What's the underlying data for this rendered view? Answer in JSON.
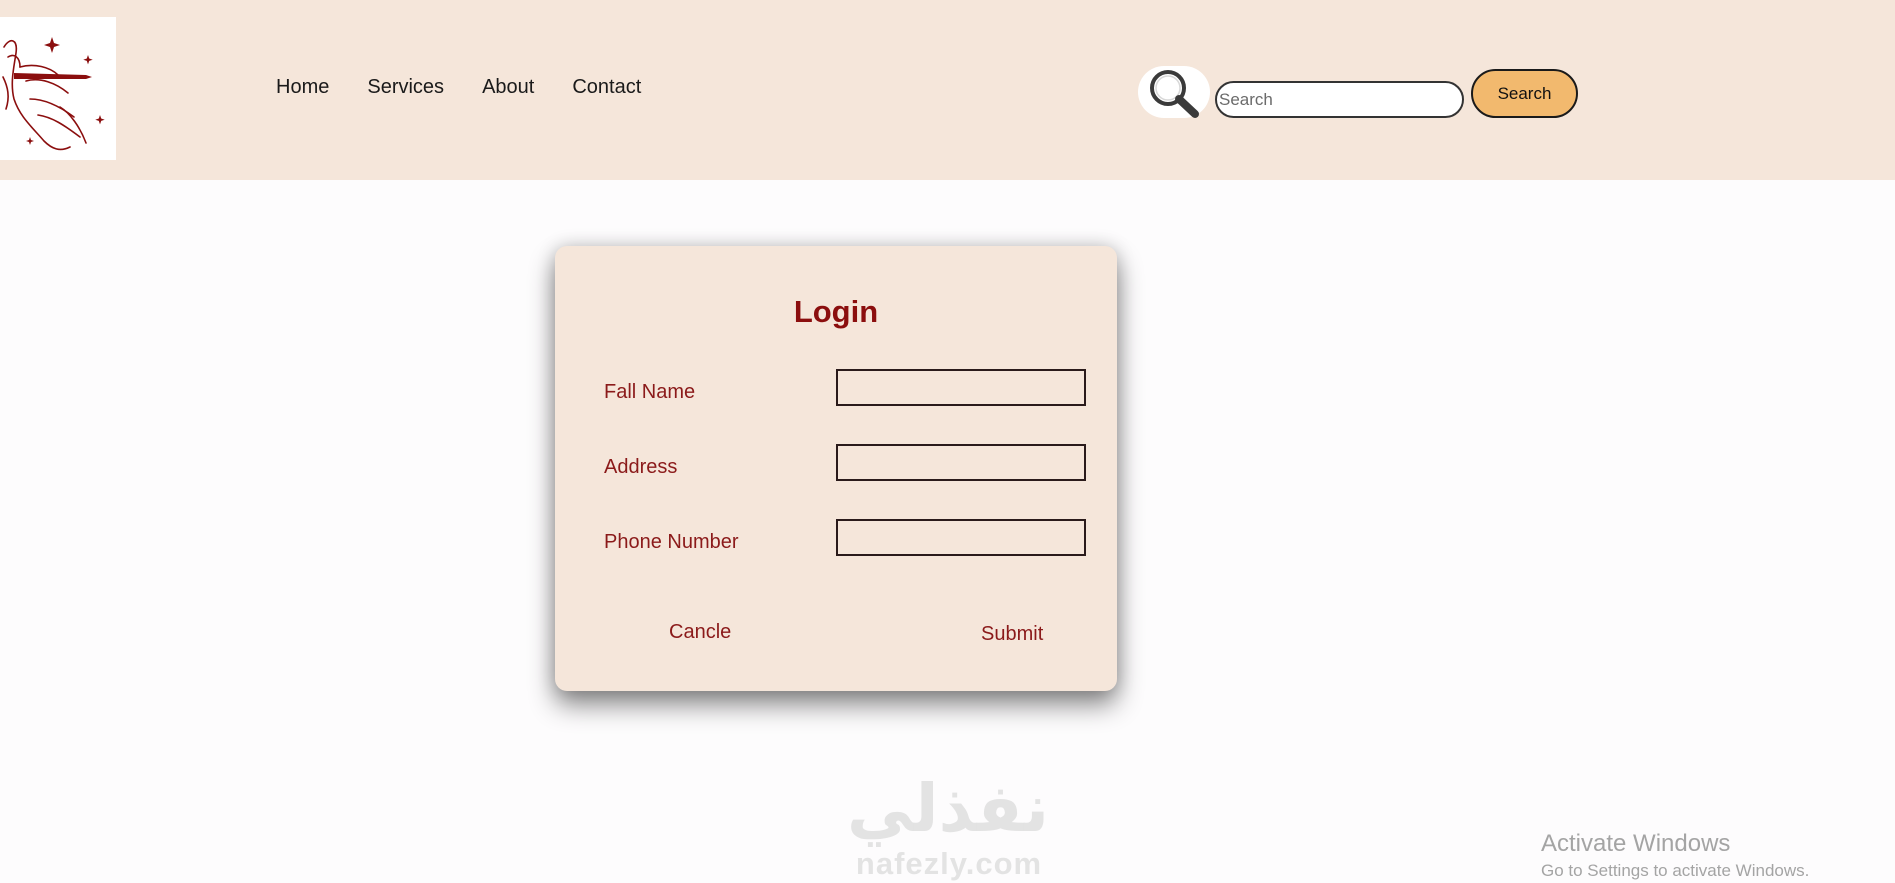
{
  "header": {
    "logo_name": "hand-holding-pen-logo",
    "nav": {
      "home": "Home",
      "services": "Services",
      "about": "About",
      "contact": "Contact"
    },
    "search": {
      "icon": "magnifier-icon",
      "placeholder": "Search",
      "value": "",
      "button_label": "Search"
    }
  },
  "login_card": {
    "title": "Login",
    "fields": {
      "full_name_label": "Fall Name",
      "address_label": "Address",
      "phone_label": "Phone Number"
    },
    "cancel_label": "Cancle",
    "submit_label": "Submit"
  },
  "watermark": {
    "arabic": "نفذلي",
    "latin": "nafezly.com"
  },
  "os_overlay": {
    "title": "Activate Windows",
    "subtitle": "Go to Settings to activate Windows."
  },
  "colors": {
    "header_bg": "#f5e6da",
    "card_bg": "#f5e6da",
    "accent_text": "#8b1a1a",
    "search_button": "#f2b96e"
  }
}
